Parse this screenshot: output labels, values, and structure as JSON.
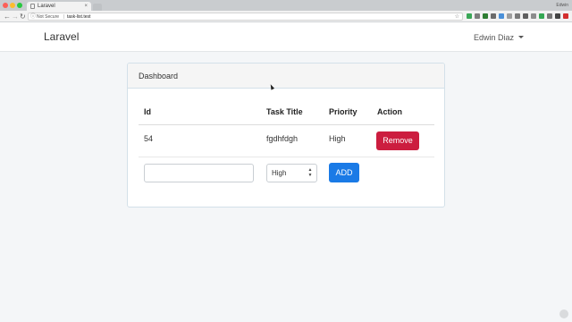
{
  "browser": {
    "tab_title": "Laravel",
    "tab_close": "×",
    "profile_name": "Edwin",
    "security_label": "Not Secure",
    "url_divider": "|",
    "url": "task-list.test",
    "icons": {
      "back": "arrow-left-icon",
      "forward": "arrow-right-icon",
      "reload": "reload-icon",
      "info": "info-icon",
      "bookmark": "star-icon"
    },
    "back_glyph": "←",
    "forward_glyph": "→",
    "reload_glyph": "↻",
    "info_glyph": "ⓘ",
    "star_glyph": "☆",
    "extension_colors": [
      "#3aa757",
      "#7d7d7d",
      "#2e7d32",
      "#6b6b6b",
      "#4a90d9",
      "#9e9e9e",
      "#7a7a7a",
      "#5f5f5f",
      "#8c8c8c",
      "#34a853",
      "#777777",
      "#444444",
      "#d32f2f"
    ]
  },
  "navbar": {
    "brand": "Laravel",
    "user_name": "Edwin Diaz"
  },
  "panel": {
    "title": "Dashboard",
    "table": {
      "headers": [
        "Id",
        "Task Title",
        "Priority",
        "Action"
      ],
      "rows": [
        {
          "id": "54",
          "title": "fgdhfdgh",
          "priority": "High",
          "action_label": "Remove"
        }
      ]
    },
    "form": {
      "task_input_value": "",
      "priority_selected": "High",
      "add_label": "ADD"
    }
  },
  "colors": {
    "danger": "#cc1d3f",
    "primary": "#1a7ae6",
    "page_bg": "#f4f6f8"
  }
}
